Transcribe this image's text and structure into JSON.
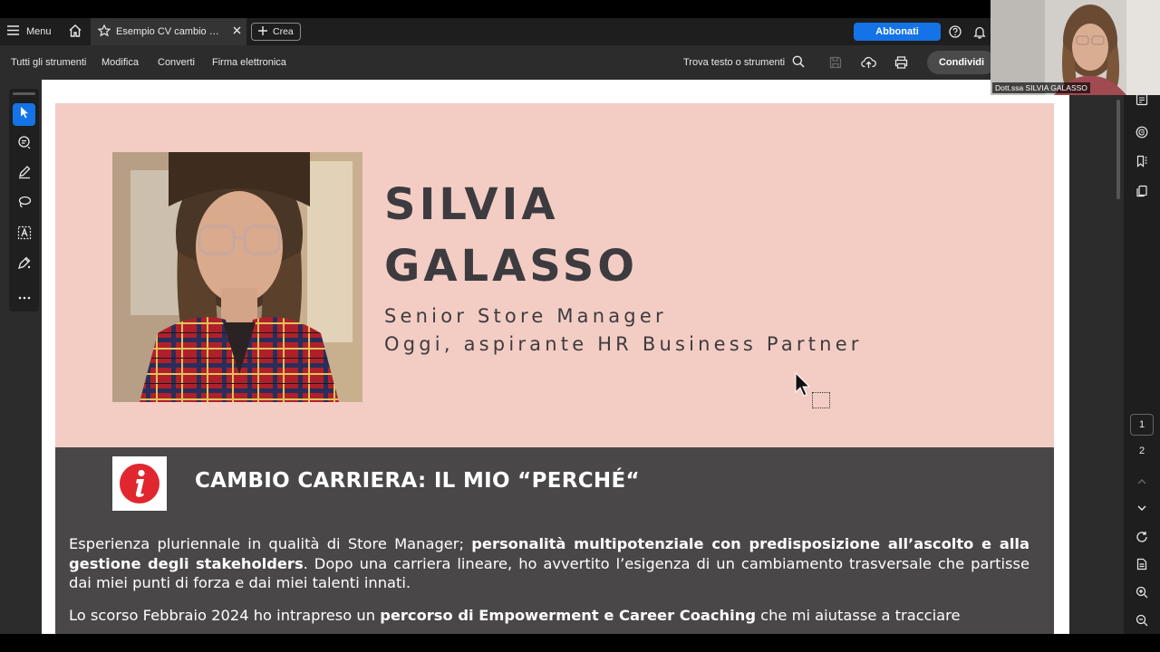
{
  "tabbar": {
    "menu_label": "Menu",
    "tab_title": "Esempio CV cambio …",
    "crea_label": "Crea",
    "abbonati_label": "Abbonati"
  },
  "toolbar": {
    "items": [
      "Tutti gli strumenti",
      "Modifica",
      "Converti",
      "Firma elettronica"
    ],
    "find_label": "Trova testo o strumenti",
    "share_label": "Condividi"
  },
  "page_nav": {
    "pages": [
      "1",
      "2"
    ],
    "current": "1"
  },
  "webcam": {
    "participant_label": "Dott.ssa SILVIA GALASSO"
  },
  "document": {
    "first_name": "SILVIA",
    "last_name": "GALASSO",
    "role_1": "Senior Store Manager",
    "role_2": "Oggi, aspirante HR Business Partner",
    "section_title": "CAMBIO CARRIERA: IL MIO “PERCHÉ“",
    "para1": {
      "t1": "Esperienza pluriennale in qualità di Store Manager; ",
      "b1": "personalità multipotenziale con predisposizione all’ascolto e alla gestione degli stakeholders",
      "t2": ". Dopo una carriera lineare, ho avvertito l’esigenza di un cambiamento trasversale che partisse dai miei punti di forza e dai miei talenti innati."
    },
    "para2": {
      "t1": "Lo scorso Febbraio 2024 ho intrapreso un ",
      "b1": "percorso di Empowerment e Career Coaching",
      "t2": " che mi aiutasse a tracciare"
    }
  },
  "colors": {
    "header_band": "#f3cdc4",
    "dark_band": "#4a4749",
    "accent_blue": "#1473e6",
    "info_red": "#e0262f",
    "name_text": "#3d3b3f"
  }
}
